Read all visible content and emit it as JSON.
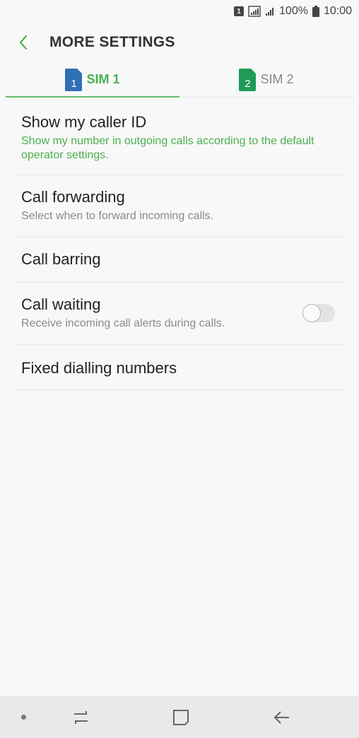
{
  "status": {
    "sim_indicator": "1",
    "battery": "100%",
    "time": "10:00"
  },
  "header": {
    "title": "MORE SETTINGS",
    "back_icon": "chevron-left-icon"
  },
  "tabs": [
    {
      "label": "SIM 1",
      "sim_number": "1",
      "active": true,
      "color": "#2f6fb5"
    },
    {
      "label": "SIM 2",
      "sim_number": "2",
      "active": false,
      "color": "#1f9a57"
    }
  ],
  "items": {
    "caller_id": {
      "title": "Show my caller ID",
      "subtitle": "Show my number in outgoing calls according to the default operator settings."
    },
    "call_forwarding": {
      "title": "Call forwarding",
      "subtitle": "Select when to forward incoming calls."
    },
    "call_barring": {
      "title": "Call barring"
    },
    "call_waiting": {
      "title": "Call waiting",
      "subtitle": "Receive incoming call alerts during calls.",
      "toggle_on": false
    },
    "fixed_dialling": {
      "title": "Fixed dialling numbers"
    }
  },
  "colors": {
    "accent_green": "#4caf50",
    "background": "#f8f8f8",
    "navbar": "#e9e9e9"
  }
}
